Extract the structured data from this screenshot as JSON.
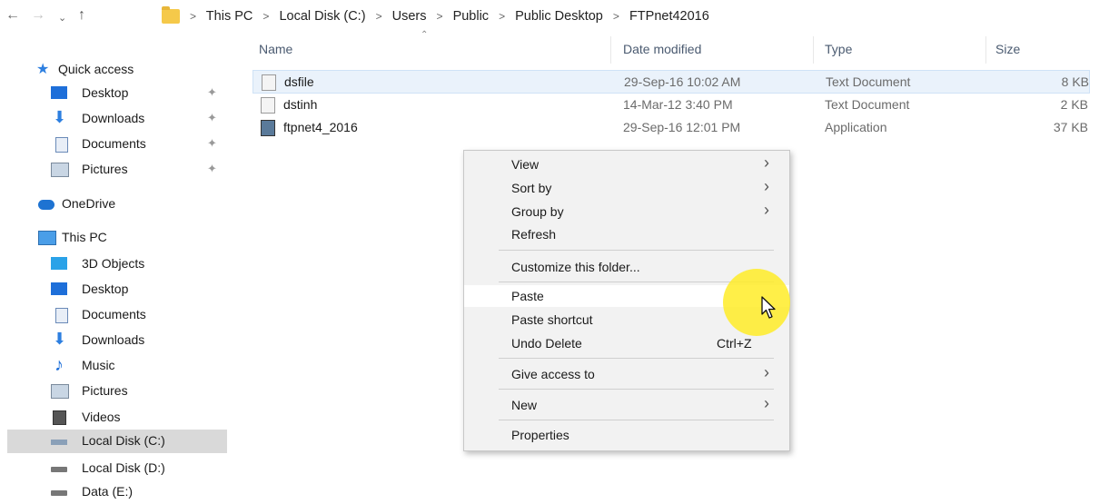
{
  "address": {
    "crumbs": [
      "This PC",
      "Local Disk (C:)",
      "Users",
      "Public",
      "Public Desktop",
      "FTPnet42016"
    ],
    "separator": ">"
  },
  "sidebar": {
    "items": [
      {
        "label": "Quick access",
        "icon": "star-icon"
      },
      {
        "label": "Desktop",
        "icon": "desktop-icon"
      },
      {
        "label": "Downloads",
        "icon": "download-icon"
      },
      {
        "label": "Documents",
        "icon": "documents-icon"
      },
      {
        "label": "Pictures",
        "icon": "pictures-icon"
      },
      {
        "label": "OneDrive",
        "icon": "cloud-icon"
      },
      {
        "label": "This PC",
        "icon": "computer-icon"
      },
      {
        "label": "3D Objects",
        "icon": "cube-icon"
      },
      {
        "label": "Desktop",
        "icon": "desktop-icon"
      },
      {
        "label": "Documents",
        "icon": "documents-icon"
      },
      {
        "label": "Downloads",
        "icon": "download-icon"
      },
      {
        "label": "Music",
        "icon": "music-icon"
      },
      {
        "label": "Pictures",
        "icon": "pictures-icon"
      },
      {
        "label": "Videos",
        "icon": "video-icon"
      },
      {
        "label": "Local Disk (C:)",
        "icon": "drive-icon"
      },
      {
        "label": "Local Disk (D:)",
        "icon": "drive-icon"
      },
      {
        "label": "Data (E:)",
        "icon": "drive-icon"
      }
    ]
  },
  "columns": {
    "name": "Name",
    "date": "Date modified",
    "type": "Type",
    "size": "Size"
  },
  "files": [
    {
      "name": "dsfile",
      "date": "29-Sep-16 10:02 AM",
      "type": "Text Document",
      "size": "8 KB"
    },
    {
      "name": "dstinh",
      "date": "14-Mar-12 3:40 PM",
      "type": "Text Document",
      "size": "2 KB"
    },
    {
      "name": "ftpnet4_2016",
      "date": "29-Sep-16 12:01 PM",
      "type": "Application",
      "size": "37 KB"
    }
  ],
  "menu": {
    "view": "View",
    "sort_by": "Sort by",
    "group_by": "Group by",
    "refresh": "Refresh",
    "customize": "Customize this folder...",
    "paste": "Paste",
    "paste_shortcut": "Paste shortcut",
    "undo_delete": "Undo Delete",
    "undo_shortcut": "Ctrl+Z",
    "give_access": "Give access to",
    "new": "New",
    "properties": "Properties"
  }
}
